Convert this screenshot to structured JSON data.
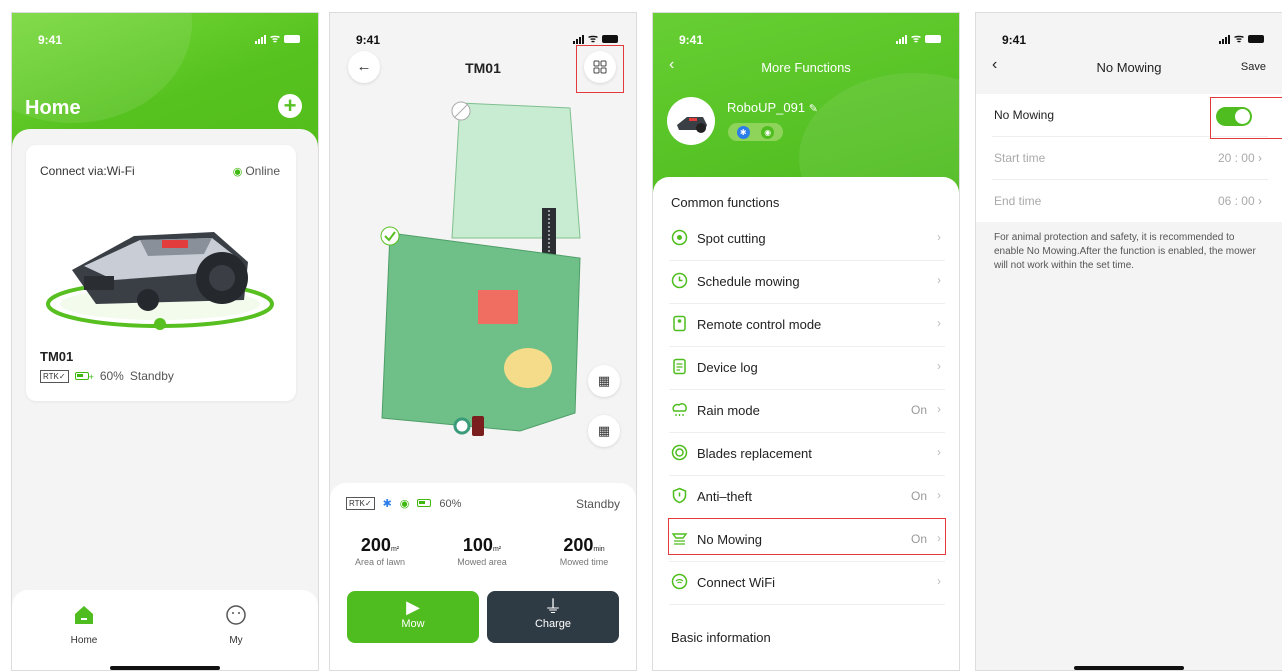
{
  "colors": {
    "brand_green": "#55c21e",
    "highlight_red": "#e03a3a",
    "lawn_light": "#c8ecd1",
    "lawn_dark": "#6ec088",
    "obstacle_red": "#f06d62",
    "obstacle_yellow": "#f5dc8a",
    "charge_dark": "#2f3b44"
  },
  "status_bar": {
    "time": "9:41",
    "icons": [
      "signal-icon",
      "wifi-icon",
      "battery-icon"
    ]
  },
  "home": {
    "title": "Home",
    "add_icon": "plus-icon",
    "card": {
      "connect_label": "Connect via:Wi-Fi",
      "online_label": "Online",
      "device_name": "TM01",
      "rtk_badge": "RTK✓",
      "battery": "60%",
      "state": "Standby"
    },
    "tabs": [
      {
        "label": "Home",
        "icon": "home-icon",
        "active": true
      },
      {
        "label": "My",
        "icon": "profile-icon",
        "active": false
      }
    ]
  },
  "map": {
    "title": "TM01",
    "back_icon": "arrow-left-icon",
    "grid_icon": "grid-icon",
    "rtk_badge": "RTK✓",
    "battery": "60%",
    "state": "Standby",
    "metrics": [
      {
        "value": "200",
        "unit": "m²",
        "label": "Area of lawn"
      },
      {
        "value": "100",
        "unit": "m²",
        "label": "Mowed area"
      },
      {
        "value": "200",
        "unit": "min",
        "label": "Mowed time"
      }
    ],
    "mow_label": "Mow",
    "charge_label": "Charge"
  },
  "functions": {
    "title": "More Functions",
    "robot_name": "RoboUP_091",
    "section_common": "Common functions",
    "items": [
      {
        "label": "Spot cutting",
        "value": "",
        "icon": "target-icon"
      },
      {
        "label": "Schedule mowing",
        "value": "",
        "icon": "clock-icon"
      },
      {
        "label": "Remote control mode",
        "value": "",
        "icon": "remote-icon"
      },
      {
        "label": "Device log",
        "value": "",
        "icon": "log-icon"
      },
      {
        "label": "Rain mode",
        "value": "On",
        "icon": "rain-icon"
      },
      {
        "label": "Blades replacement",
        "value": "",
        "icon": "blade-icon"
      },
      {
        "label": "Anti–theft",
        "value": "On",
        "icon": "shield-icon"
      },
      {
        "label": "No Mowing",
        "value": "On",
        "icon": "no-mowing-icon"
      },
      {
        "label": "Connect WiFi",
        "value": "",
        "icon": "wifi-connect-icon"
      }
    ],
    "section_basic": "Basic information"
  },
  "no_mowing": {
    "title": "No Mowing",
    "save_label": "Save",
    "toggle_label": "No Mowing",
    "toggle_on": true,
    "start_label": "Start time",
    "start_value": "20 : 00",
    "end_label": "End time",
    "end_value": "06 : 00",
    "note": "For animal protection and safety, it is recommended to enable No Mowing.After the function is enabled, the mower will not work within the set time."
  }
}
